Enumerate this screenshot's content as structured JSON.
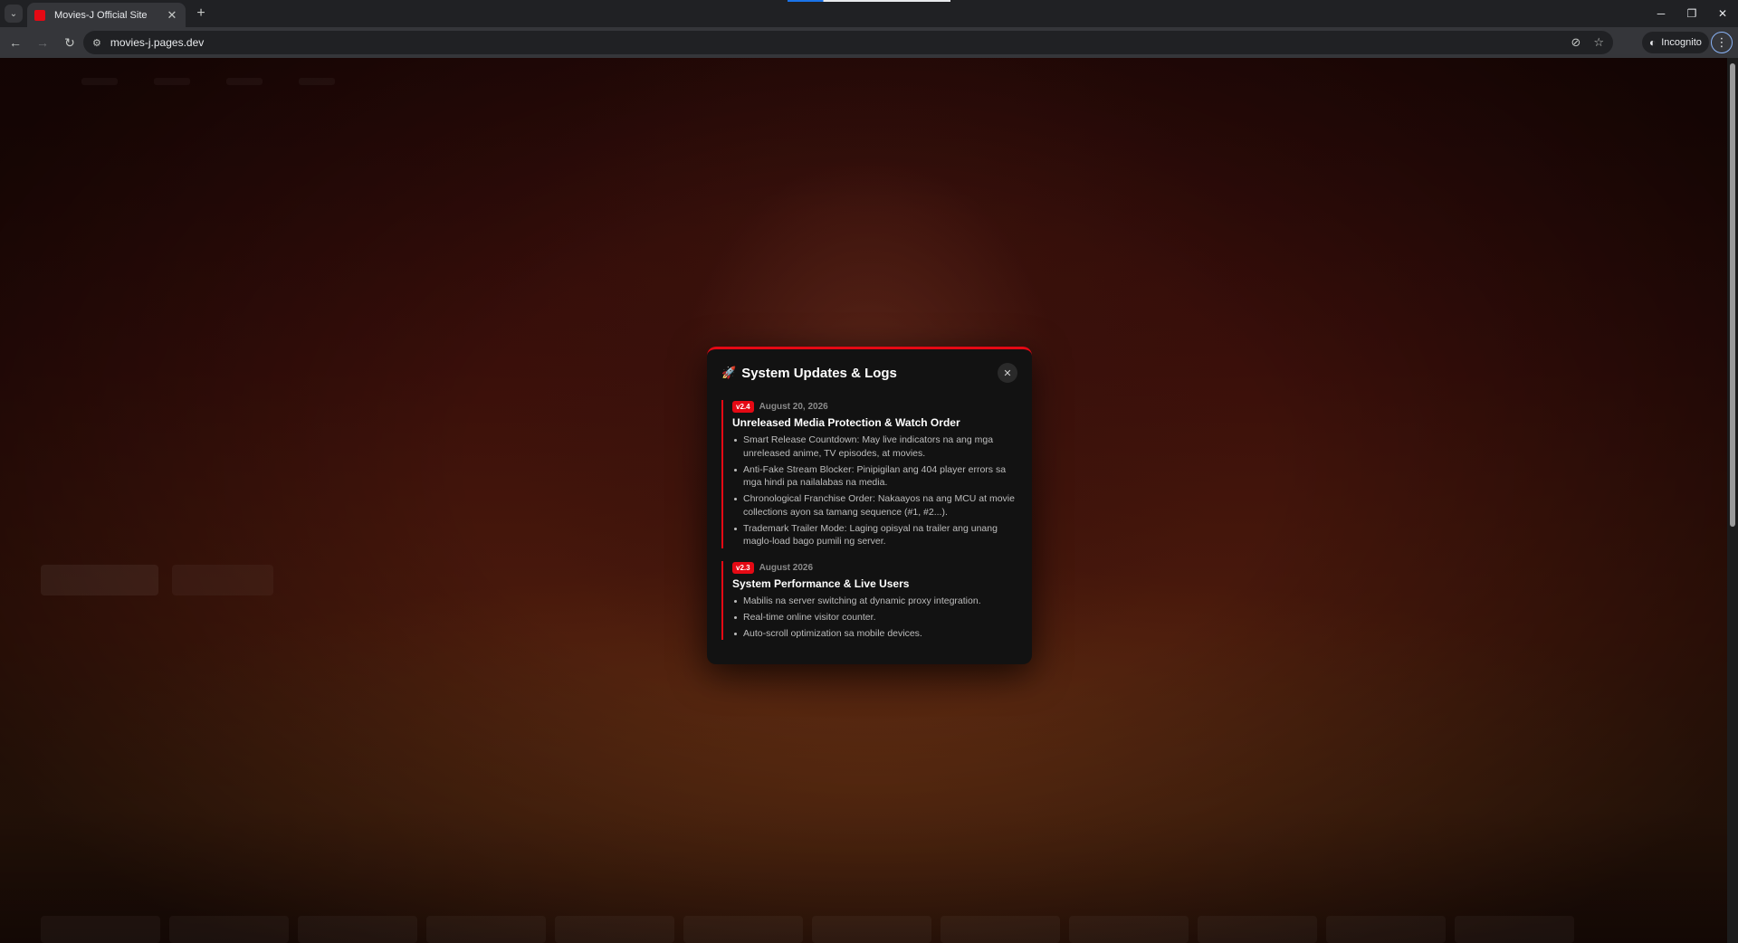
{
  "browser": {
    "tab_title": "Movies-J Official Site",
    "url": "movies-j.pages.dev",
    "incognito_label": "Incognito",
    "icons": {
      "tab_search": "chevron-down-icon",
      "tab_close": "close-icon",
      "new_tab": "plus-icon",
      "back": "arrow-left-icon",
      "forward": "arrow-right-icon",
      "reload": "reload-icon",
      "site_info": "tune-icon",
      "eye_off": "eye-off-icon",
      "bookmark": "star-icon",
      "incognito": "incognito-icon",
      "menu": "kebab-icon",
      "minimize": "minimize-icon",
      "restore": "restore-icon",
      "close": "close-icon"
    }
  },
  "modal": {
    "title": "System Updates & Logs",
    "icon": "rocket-icon",
    "close_icon": "close-icon",
    "accent_color": "#e50914",
    "releases": [
      {
        "version": "v2.4",
        "date": "August 20, 2026",
        "title": "Unreleased Media Protection & Watch Order",
        "items": [
          "Smart Release Countdown: May live indicators na ang mga unreleased anime, TV episodes, at movies.",
          "Anti-Fake Stream Blocker: Pinipigilan ang 404 player errors sa mga hindi pa nailalabas na media.",
          "Chronological Franchise Order: Nakaayos na ang MCU at movie collections ayon sa tamang sequence (#1, #2...).",
          "Trademark Trailer Mode: Laging opisyal na trailer ang unang maglo-load bago pumili ng server."
        ]
      },
      {
        "version": "v2.3",
        "date": "August 2026",
        "title": "System Performance & Live Users",
        "items": [
          "Mabilis na server switching at dynamic proxy integration.",
          "Real-time online visitor counter.",
          "Auto-scroll optimization sa mobile devices."
        ]
      }
    ]
  }
}
